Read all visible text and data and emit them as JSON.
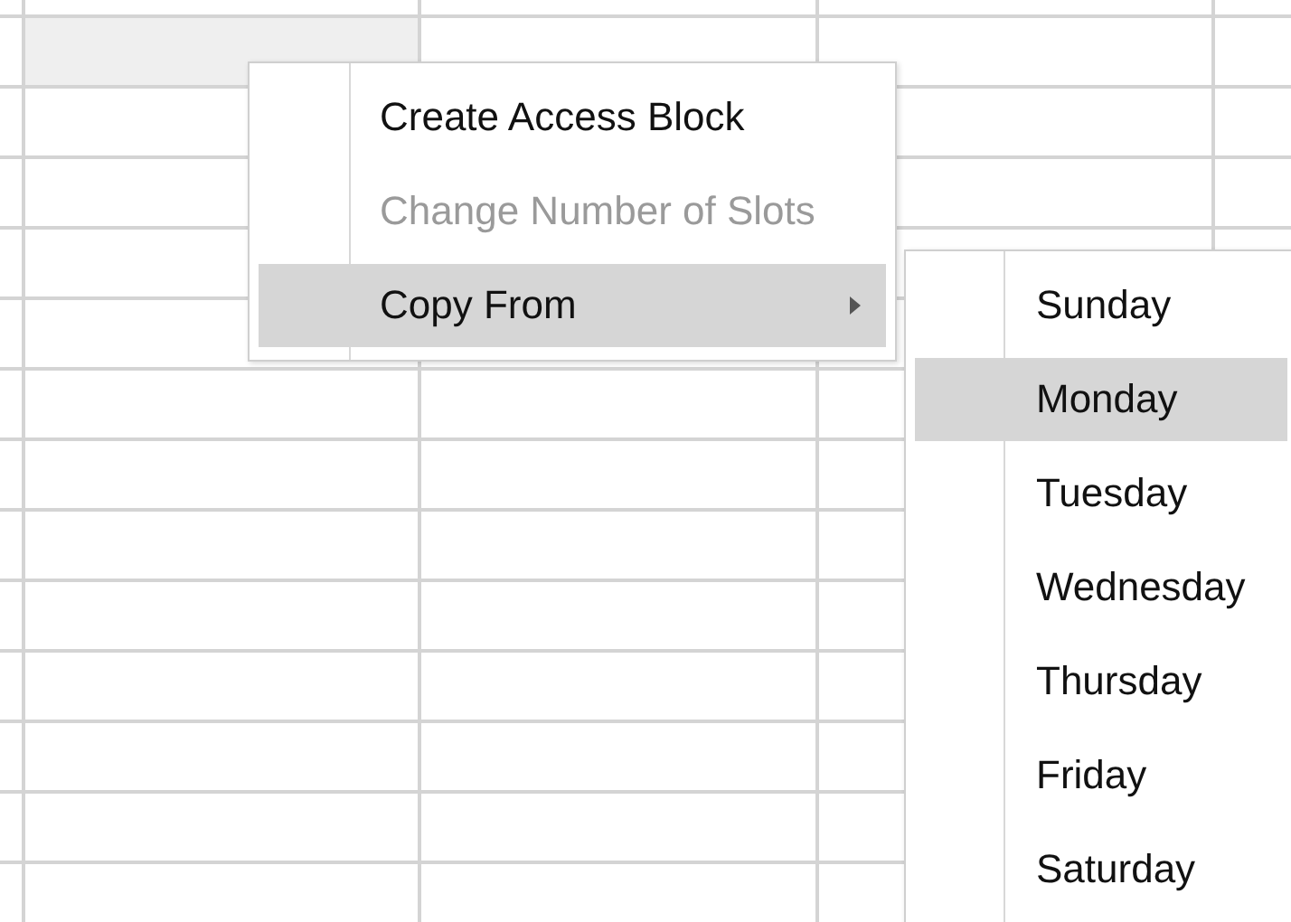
{
  "context_menu": {
    "items": [
      {
        "label": "Create Access Block",
        "disabled": false,
        "selected": false,
        "has_submenu": false
      },
      {
        "label": "Change Number of Slots",
        "disabled": true,
        "selected": false,
        "has_submenu": false
      },
      {
        "label": "Copy From",
        "disabled": false,
        "selected": true,
        "has_submenu": true
      }
    ]
  },
  "submenu": {
    "items": [
      {
        "label": "Sunday",
        "selected": false
      },
      {
        "label": "Monday",
        "selected": true
      },
      {
        "label": "Tuesday",
        "selected": false
      },
      {
        "label": "Wednesday",
        "selected": false
      },
      {
        "label": "Thursday",
        "selected": false
      },
      {
        "label": "Friday",
        "selected": false
      },
      {
        "label": "Saturday",
        "selected": false
      }
    ]
  }
}
